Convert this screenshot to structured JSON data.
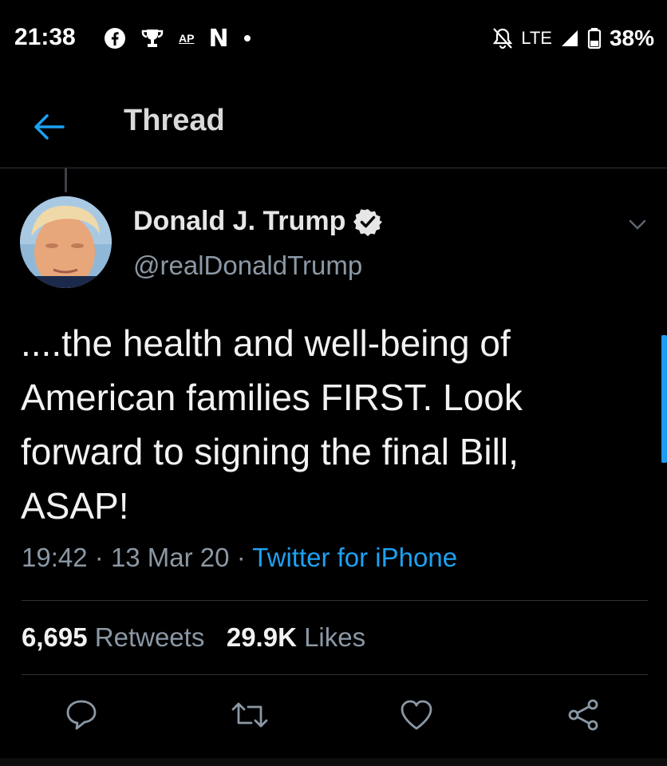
{
  "status_bar": {
    "time": "21:38",
    "left_icons": [
      "facebook-icon",
      "trophy-icon",
      "ap-news-icon",
      "netflix-icon",
      "dot-icon"
    ],
    "ap_label": "AP",
    "n_label": "N",
    "network": "LTE",
    "battery": "38%"
  },
  "header": {
    "title": "Thread",
    "back_icon": "back-arrow-icon",
    "accent": "#1da1f2"
  },
  "tweet": {
    "author_name": "Donald J. Trump",
    "handle": "@realDonaldTrump",
    "verified": true,
    "text_lines": [
      "....the health and well-being of",
      "American families FIRST. Look",
      "forward to signing the final Bill,",
      "ASAP!"
    ],
    "time": "19:42",
    "date": "13 Mar 20",
    "sep": "·",
    "source": "Twitter for iPhone",
    "retweets_count": "6,695",
    "retweets_label": "Retweets",
    "likes_count": "29.9K",
    "likes_label": "Likes"
  },
  "actions": [
    "reply-icon",
    "retweet-icon",
    "like-icon",
    "share-icon"
  ],
  "colors": {
    "background": "#000000",
    "secondary_text": "#8b98a5",
    "link": "#1da1f2"
  }
}
